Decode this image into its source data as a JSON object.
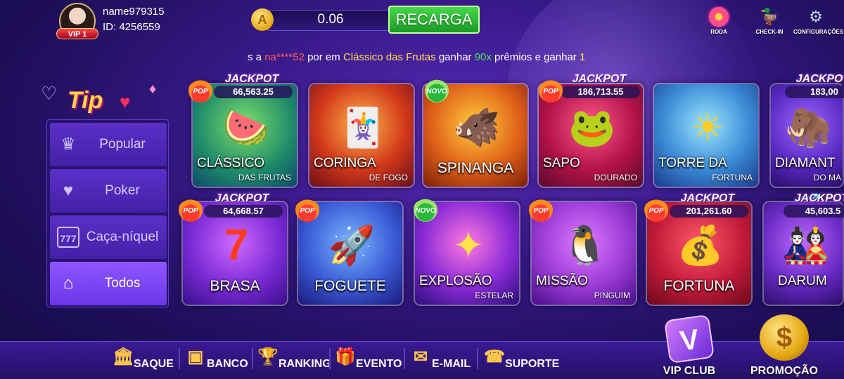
{
  "user": {
    "name": "name979315",
    "id": "ID: 4256559",
    "vip": "VIP 1"
  },
  "balance": {
    "value": "0.06",
    "recharge_label": "RECARGA",
    "coin_symbol": "A"
  },
  "top_icons": [
    {
      "label": "RODA",
      "icon": "wheel-icon"
    },
    {
      "label": "CHECK-IN",
      "icon": "duck-icon"
    },
    {
      "label": "CONFIGURAÇÕES",
      "icon": "gear-icon"
    }
  ],
  "marquee": {
    "p1": "s a ",
    "p2": "na****52",
    "p3": " por em ",
    "p4": "Clássico das Frutas",
    "p5": " ganhar ",
    "p6": "90x",
    "p7": " prêmios e ganhar ",
    "p8": "1"
  },
  "tip_logo": "Tip",
  "sidebar": {
    "items": [
      {
        "label": "Popular",
        "icon": "crown-icon"
      },
      {
        "label": "Poker",
        "icon": "cards-icon"
      },
      {
        "label": "Caça-níquel",
        "icon": "slot-icon"
      },
      {
        "label": "Todos",
        "icon": "home-icon"
      }
    ]
  },
  "jackpot_label": "JACKPOT",
  "games": [
    {
      "name1": "CLÁSSICO",
      "name2": "DAS FRUTAS",
      "jackpot": "66,563.25",
      "badge": "POP"
    },
    {
      "name1": "CORINGA",
      "name2": "DE FOGO",
      "jackpot": "",
      "badge": ""
    },
    {
      "name1": "SPINANGA",
      "name2": "",
      "jackpot": "",
      "badge": "NOVO"
    },
    {
      "name1": "SAPO",
      "name2": "DOURADO",
      "jackpot": "186,713.55",
      "badge": "POP"
    },
    {
      "name1": "TORRE DA",
      "name2": "FORTUNA",
      "jackpot": "",
      "badge": ""
    },
    {
      "name1": "DIAMANT",
      "name2": "DO MA",
      "jackpot": "183,00",
      "badge": ""
    },
    {
      "name1": "BRASA",
      "name2": "",
      "jackpot": "64,668.57",
      "badge": "POP"
    },
    {
      "name1": "FOGUETE",
      "name2": "",
      "jackpot": "",
      "badge": "POP"
    },
    {
      "name1": "EXPLOSÃO",
      "name2": "ESTELAR",
      "jackpot": "",
      "badge": "NOVO"
    },
    {
      "name1": "MISSÃO",
      "name2": "PINGUIM",
      "jackpot": "",
      "badge": "POP"
    },
    {
      "name1": "FORTUNA",
      "name2": "",
      "jackpot": "201,261.60",
      "badge": "POP"
    },
    {
      "name1": "DARUM",
      "name2": "",
      "jackpot": "45,603.5",
      "badge": ""
    }
  ],
  "bottom_nav": [
    {
      "label": "SAQUE",
      "icon": "bank-building-icon"
    },
    {
      "label": "BANCO",
      "icon": "safe-icon"
    },
    {
      "label": "RANKING",
      "icon": "trophy-icon"
    },
    {
      "label": "EVENTO",
      "icon": "gift-icon"
    },
    {
      "label": "E-MAIL",
      "icon": "envelope-icon"
    },
    {
      "label": "SUPORTE",
      "icon": "support-24h-icon"
    }
  ],
  "vip_club": {
    "label": "VIP CLUB",
    "icon_text": "V"
  },
  "promo": {
    "label": "PROMOÇÃO",
    "icon_text": "$"
  }
}
